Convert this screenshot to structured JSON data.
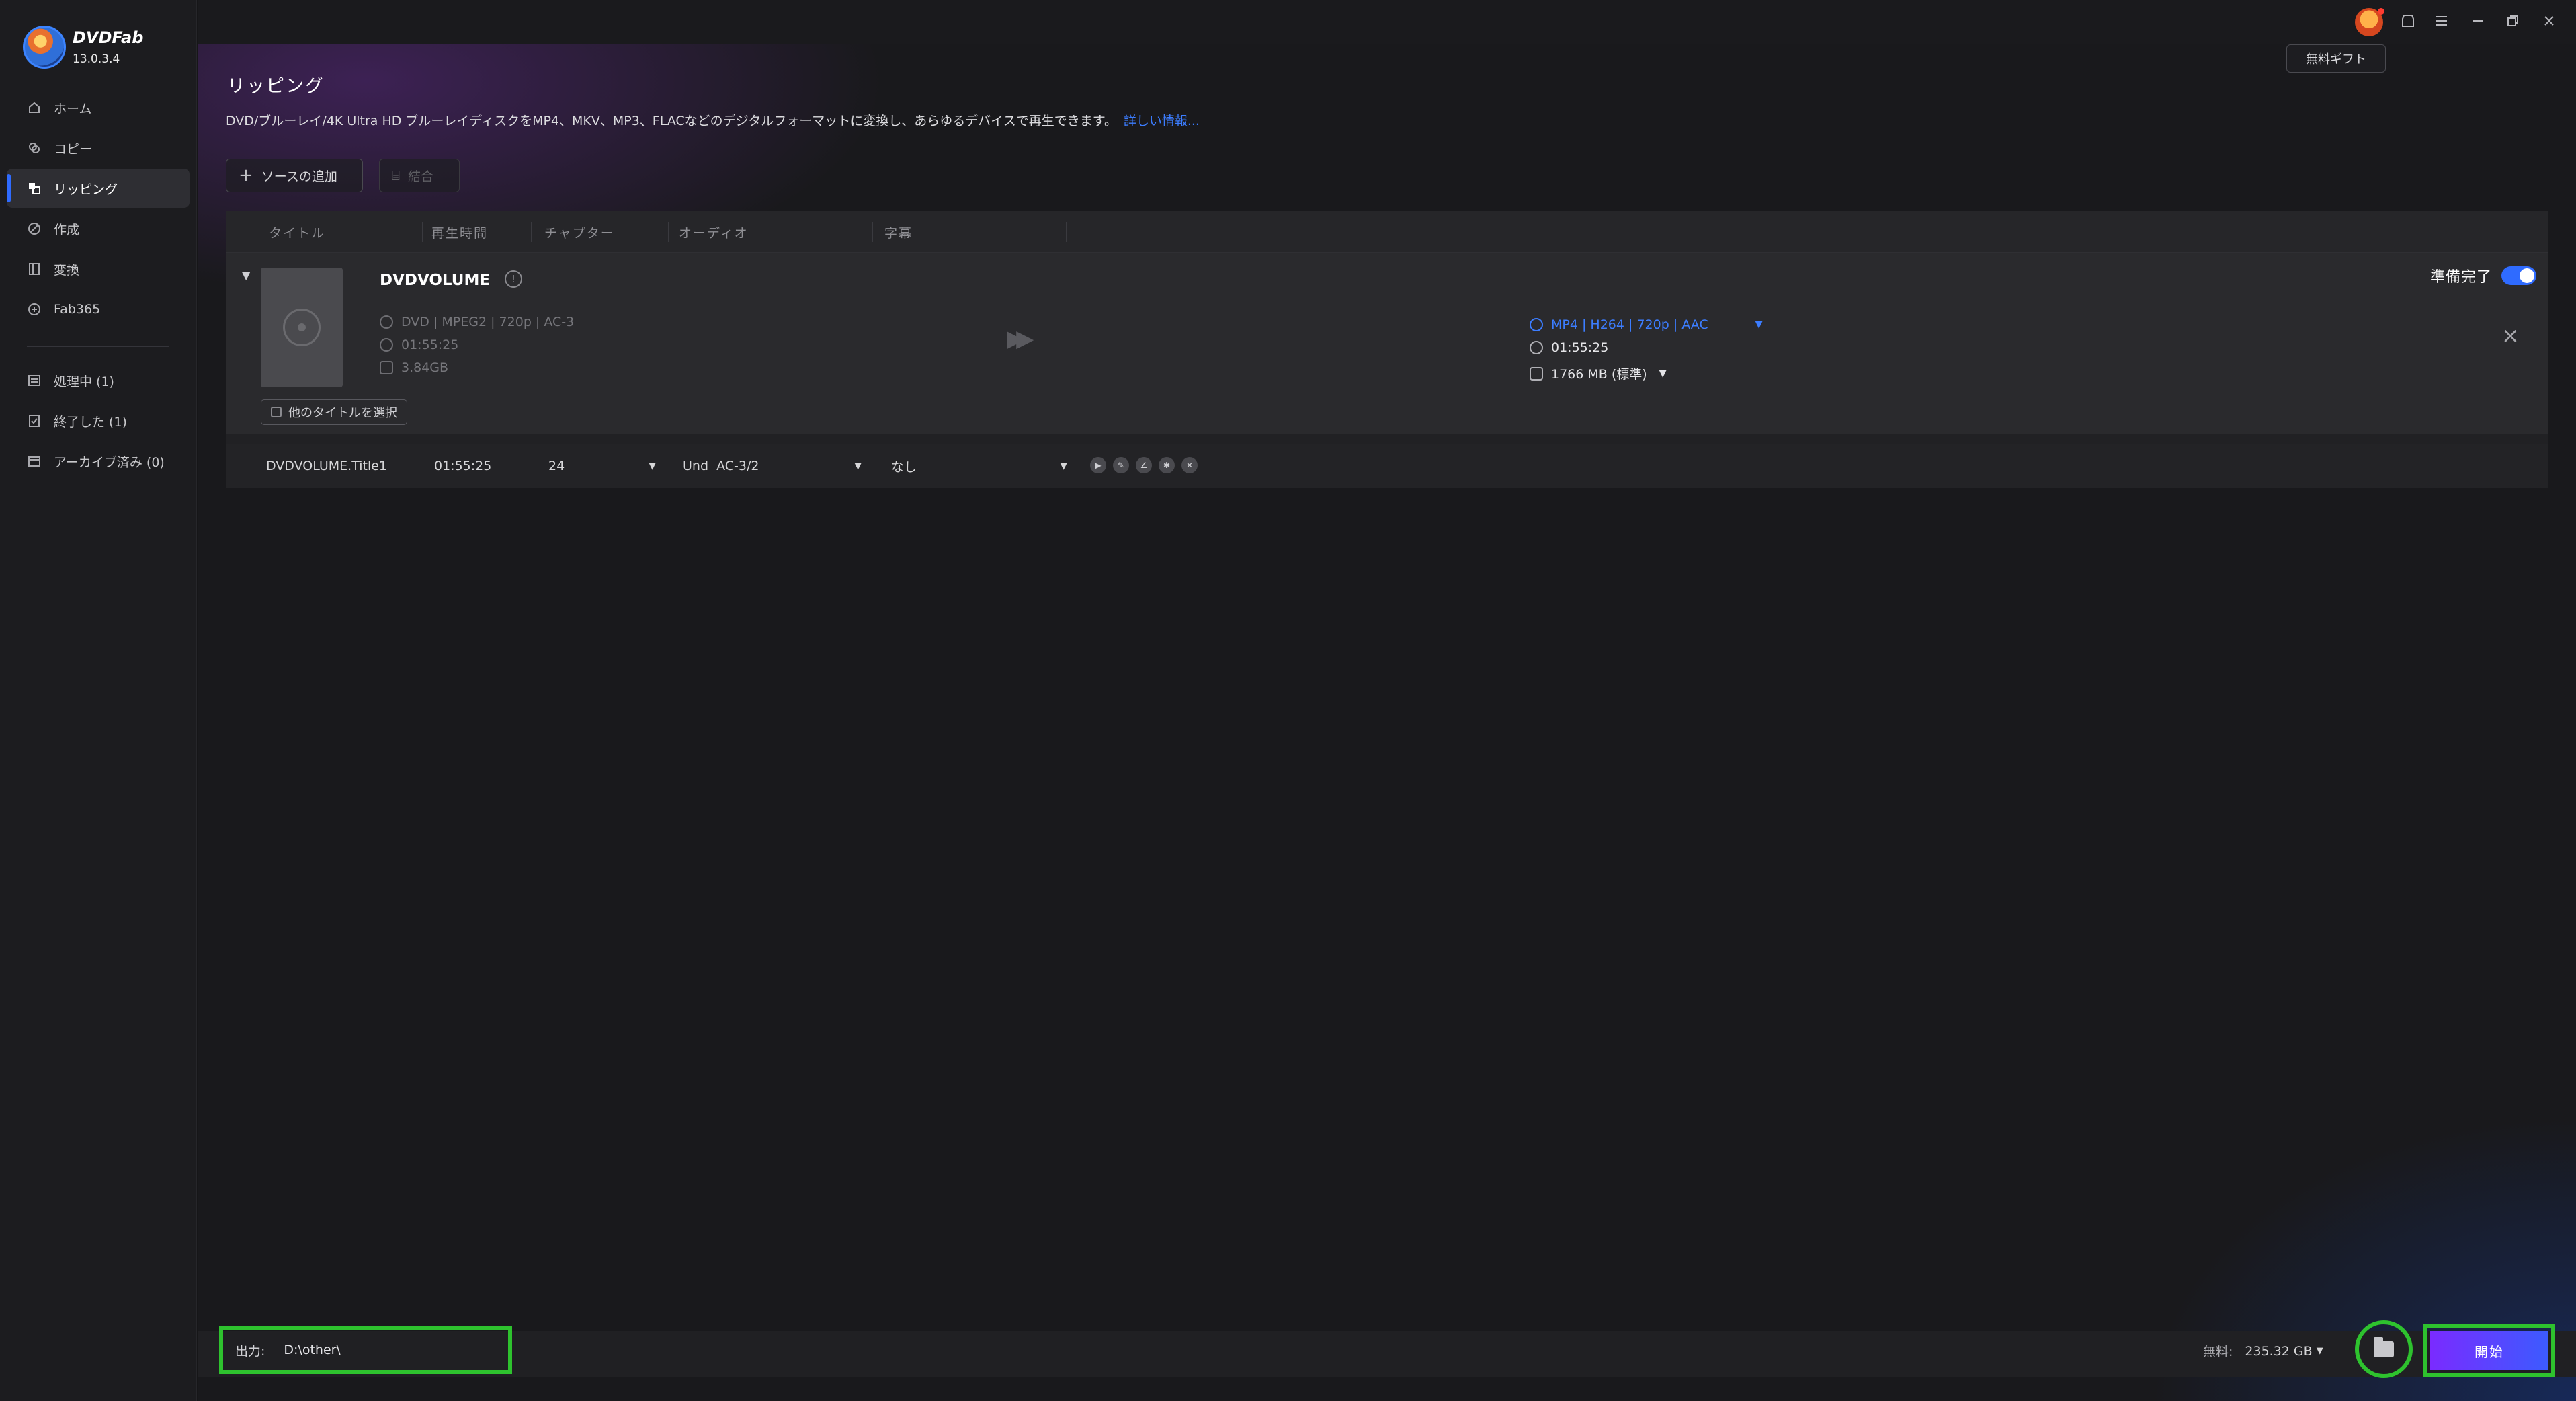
{
  "app": {
    "name": "DVDFab",
    "version": "13.0.3.4"
  },
  "sidebar": {
    "items": [
      {
        "label": "ホーム",
        "icon": "home-icon"
      },
      {
        "label": "コピー",
        "icon": "copy-icon"
      },
      {
        "label": "リッピング",
        "icon": "ripper-icon",
        "active": true
      },
      {
        "label": "作成",
        "icon": "creator-icon"
      },
      {
        "label": "変換",
        "icon": "converter-icon"
      },
      {
        "label": "Fab365",
        "icon": "fab365-icon"
      }
    ],
    "queue": [
      {
        "label": "処理中 (1)",
        "icon": "processing-icon"
      },
      {
        "label": "終了した (1)",
        "icon": "finished-icon"
      },
      {
        "label": "アーカイブ済み (0)",
        "icon": "archive-icon"
      }
    ]
  },
  "titlebar": {
    "gift_tooltip": "無料ギフト"
  },
  "page": {
    "title": "リッピング",
    "description": "DVD/ブルーレイ/4K Ultra HD ブルーレイディスクをMP4、MKV、MP3、FLACなどのデジタルフォーマットに変換し、あらゆるデバイスで再生できます。",
    "more_link": "詳しい情報...",
    "add_source": "ソースの追加",
    "merge": "結合"
  },
  "table": {
    "headers": [
      "タイトル",
      "再生時間",
      "チャプター",
      "オーディオ",
      "字幕"
    ],
    "source": {
      "name": "DVDVOLUME",
      "format": "DVD | MPEG2 | 720p | AC-3",
      "duration": "01:55:25",
      "size": "3.84GB",
      "other_titles": "他のタイトルを選択",
      "output_profile": "MP4 | H264 | 720p | AAC",
      "output_duration": "01:55:25",
      "output_size": "1766 MB (標準)",
      "status": "準備完了"
    },
    "title_row": {
      "name": "DVDVOLUME.Title1",
      "duration": "01:55:25",
      "chapters": "24",
      "audio": "Und  AC-3/2",
      "subtitle": "なし"
    }
  },
  "bottom": {
    "output_label": "出力:",
    "output_path": "D:\\other\\",
    "free_label": "無料:",
    "free_value": "235.32 GB",
    "start": "開始"
  },
  "colors": {
    "accent": "#2f6bff",
    "highlight": "#2ec22e",
    "start_gradient": [
      "#7a2bff",
      "#3c5bff"
    ]
  }
}
